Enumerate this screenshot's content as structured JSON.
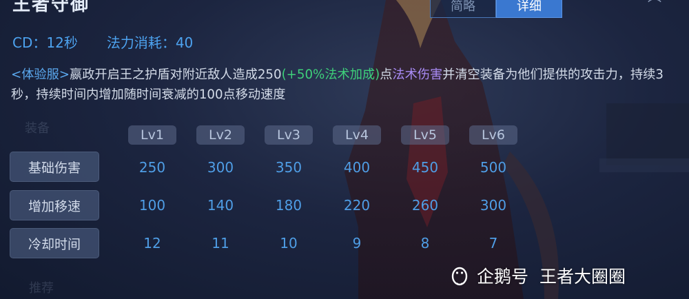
{
  "skill": {
    "title": "王者守御"
  },
  "mode_tabs": [
    {
      "label": "简略",
      "active": false
    },
    {
      "label": "详细",
      "active": true
    }
  ],
  "stats": {
    "cd": "CD：12秒",
    "mana": "法力消耗：40"
  },
  "description": {
    "server_tag": "<体验服>",
    "part1": "嬴政开启王之护盾对附近敌人造成250",
    "bonus": "(+50%法术加成)",
    "part2": "点",
    "damage_type": "法术伤害",
    "part3": "并清空装备为他们提供的攻击力，持续3秒，持续时间内增加随时间衰减的100点移动速度"
  },
  "levels": [
    "Lv1",
    "Lv2",
    "Lv3",
    "Lv4",
    "Lv5",
    "Lv6"
  ],
  "rows": [
    {
      "label": "基础伤害",
      "values": [
        "250",
        "300",
        "350",
        "400",
        "450",
        "500"
      ]
    },
    {
      "label": "增加移速",
      "values": [
        "100",
        "140",
        "180",
        "220",
        "260",
        "300"
      ]
    },
    {
      "label": "冷却时间",
      "values": [
        "12",
        "11",
        "10",
        "9",
        "8",
        "7"
      ]
    }
  ],
  "ghost": {
    "top": "装备",
    "bottom": "推荐"
  },
  "watermark": {
    "platform": "企鹅号",
    "author": "王者大圈圈",
    "icon": "penguin-icon"
  },
  "colors": {
    "accent_blue": "#4da3f0",
    "bonus_green": "#3ed07a",
    "damage_purple": "#a98bf5",
    "active_tab": "#3a78d0"
  }
}
